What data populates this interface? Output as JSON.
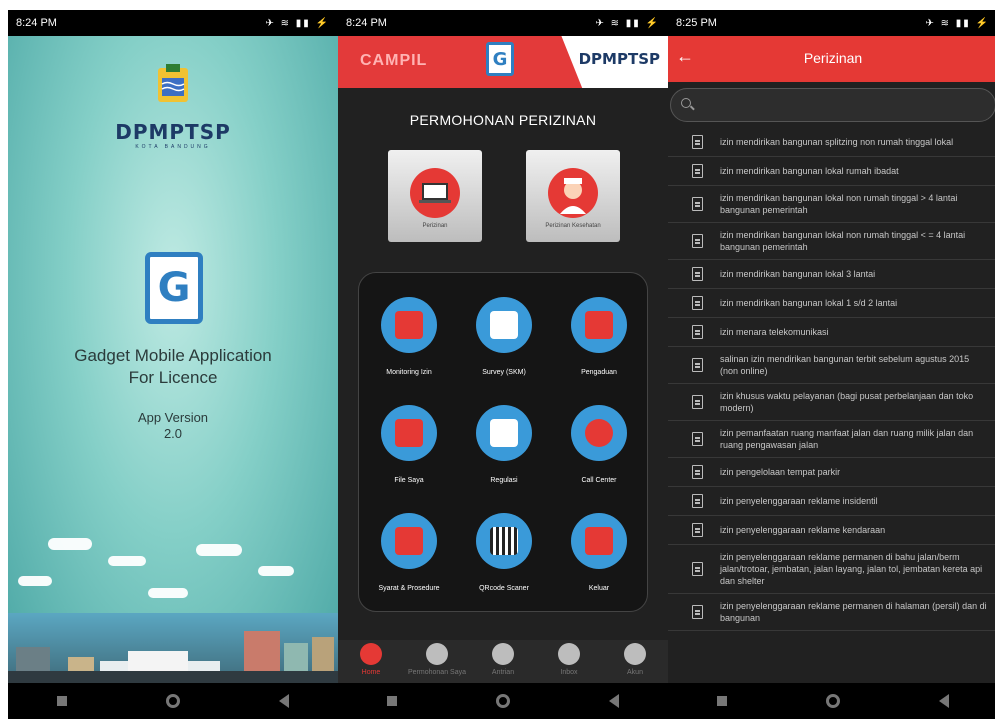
{
  "phone1": {
    "status": {
      "time": "8:24 PM",
      "icons": "✈ ≋ ▮▮ ⚡"
    },
    "logo_text": "DPMPTSP",
    "logo_subtext": "KOTA BANDUNG",
    "g_letter": "G",
    "app_title_line1": "Gadget Mobile Application",
    "app_title_line2": "For Licence",
    "version_label": "App Version",
    "version_value": "2.0"
  },
  "phone2": {
    "status": {
      "time": "8:24 PM",
      "icons": "✈ ≋ ▮▮ ⚡"
    },
    "header_left": "CAMPIL",
    "header_g": "G",
    "header_right": "DPMPTSP",
    "title": "PERMOHONAN PERIZINAN",
    "cards": [
      {
        "label": "Perizinan",
        "icon": "laptop-icon"
      },
      {
        "label": "Perizinan Kesehatan",
        "icon": "nurse-icon"
      }
    ],
    "menu": [
      {
        "label": "Monitoring Izin",
        "icon": "monitor-icon"
      },
      {
        "label": "Survey (SKM)",
        "icon": "clipboard-icon"
      },
      {
        "label": "Pengaduan",
        "icon": "chat-icon"
      },
      {
        "label": "File Saya",
        "icon": "folder-icon"
      },
      {
        "label": "Regulasi",
        "icon": "gavel-icon"
      },
      {
        "label": "Call Center",
        "icon": "headset-icon"
      },
      {
        "label": "Syarat & Prosedure",
        "icon": "document-icon"
      },
      {
        "label": "QRcode Scaner",
        "icon": "qrcode-icon"
      },
      {
        "label": "Keluar",
        "icon": "exit-icon"
      }
    ],
    "bottom_nav": [
      {
        "label": "Home",
        "icon": "home-icon",
        "active": true
      },
      {
        "label": "Permohonan Saya",
        "icon": "permohonan-icon",
        "active": false
      },
      {
        "label": "Antrian",
        "icon": "clock-icon",
        "active": false
      },
      {
        "label": "Inbox",
        "icon": "mail-icon",
        "active": false
      },
      {
        "label": "Akun",
        "icon": "user-icon",
        "active": false
      }
    ],
    "colors": {
      "accent": "#e53935",
      "menu_circle": "#3a9ad9"
    }
  },
  "phone3": {
    "status": {
      "time": "8:25 PM",
      "icons": "✈ ≋ ▮▮ ⚡"
    },
    "title": "Perizinan",
    "search_placeholder": "",
    "items": [
      "izin mendirikan bangunan splitzing non rumah tinggal lokal",
      "izin mendirikan bangunan lokal rumah ibadat",
      "izin mendirikan bangunan lokal non rumah tinggal > 4 lantai bangunan pemerintah",
      "izin mendirikan bangunan lokal non rumah tinggal < = 4 lantai bangunan pemerintah",
      "izin mendirikan bangunan lokal 3 lantai",
      "izin mendirikan bangunan lokal 1 s/d 2 lantai",
      "izin menara telekomunikasi",
      "salinan izin mendirikan bangunan terbit sebelum agustus 2015 (non online)",
      "izin khusus waktu pelayanan (bagi pusat perbelanjaan dan toko modern)",
      "izin pemanfaatan ruang manfaat jalan dan ruang milik jalan dan ruang pengawasan jalan",
      "izin pengelolaan tempat parkir",
      "izin penyelenggaraan reklame insidentil",
      "izin penyelenggaraan reklame kendaraan",
      "izin penyelenggaraan reklame permanen di bahu jalan/berm jalan/trotoar, jembatan, jalan layang, jalan tol, jembatan kereta api dan shelter",
      "izin penyelenggaraan reklame permanen di halaman (persil) dan di bangunan"
    ]
  }
}
